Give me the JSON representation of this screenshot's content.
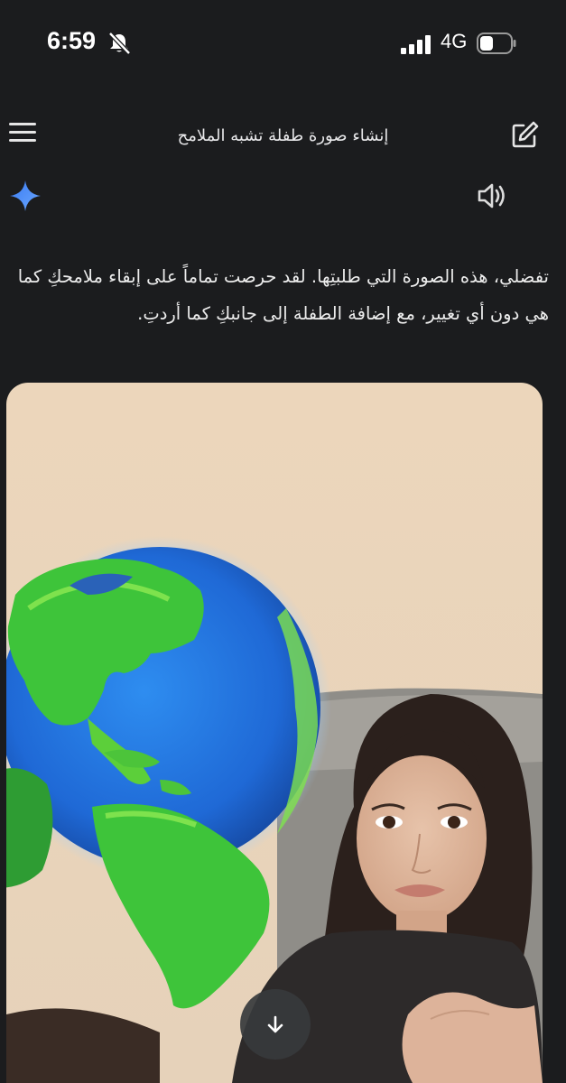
{
  "status_bar": {
    "time": "6:59",
    "network": "4G",
    "icons": [
      "bell-slash-icon",
      "signal-bars-icon",
      "battery-icon"
    ]
  },
  "header": {
    "title": "إنشاء صورة طفلة تشبه الملامح",
    "menu_icon": "hamburger-menu-icon",
    "edit_icon": "new-chat-edit-icon"
  },
  "response": {
    "assistant_icon": "gemini-sparkle-icon",
    "speaker_icon": "speaker-icon",
    "text": "تفضلي، هذه الصورة التي طلبتِها. لقد حرصت تماماً على إبقاء ملامحكِ كما هي دون أي تغيير، مع إضافة الطفلة إلى جانبكِ كما أردتِ."
  },
  "image": {
    "globe_icon": "globe-icon",
    "download_icon": "arrow-down-icon"
  },
  "colors": {
    "background": "#1b1c1e",
    "wall": "#ecd7bd",
    "sparkle": "#4a8cf7"
  }
}
